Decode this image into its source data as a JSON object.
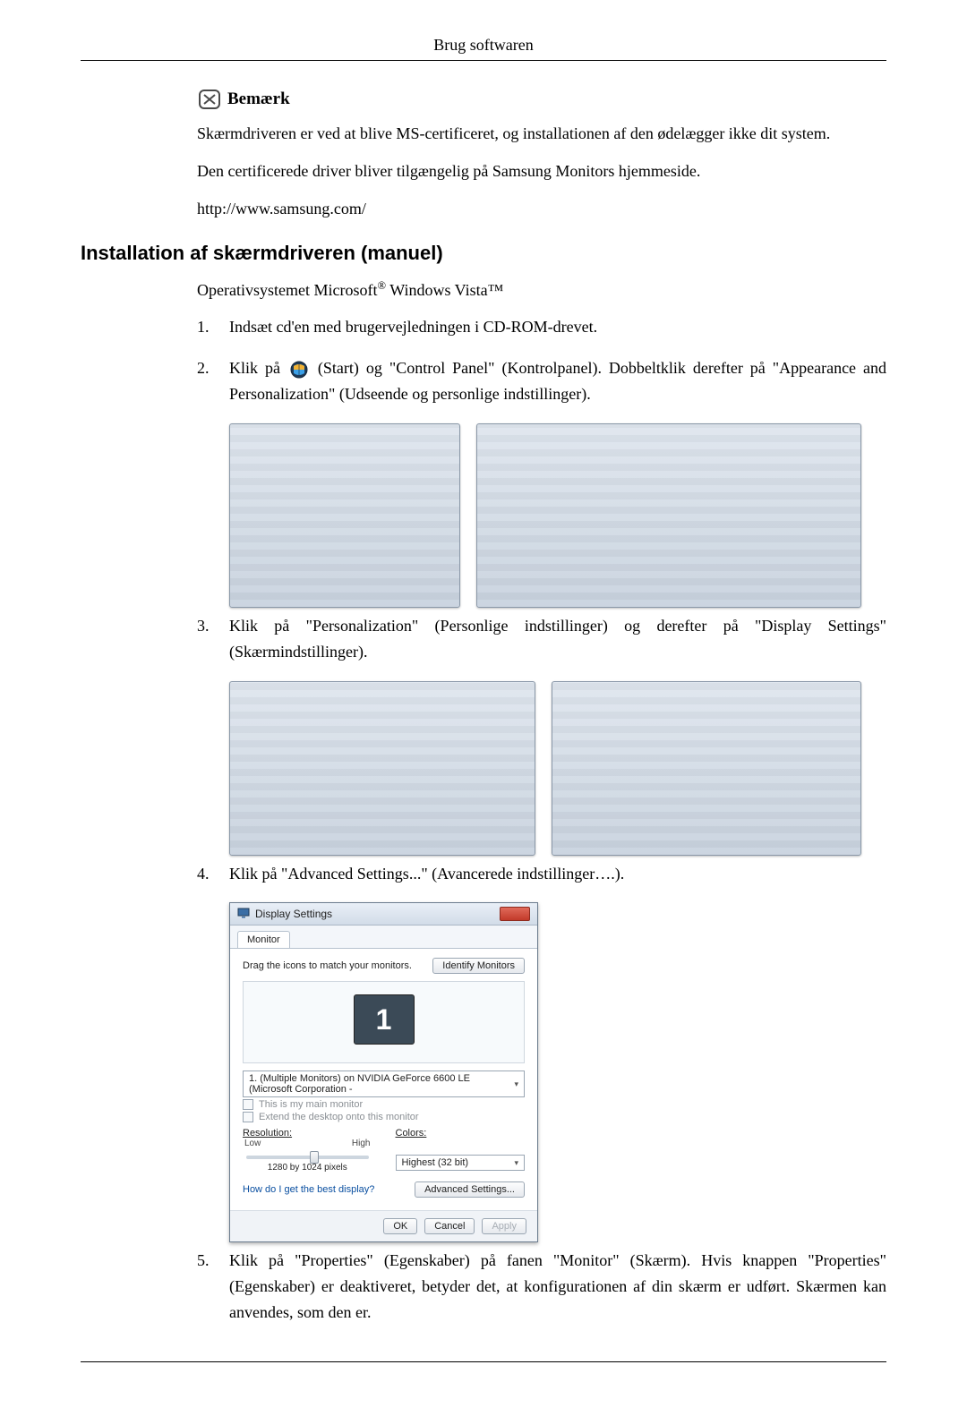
{
  "page_header": "Brug softwaren",
  "note": {
    "title": "Bemærk",
    "lines": [
      "Skærmdriveren er ved at blive MS-certificeret, og installationen af den ødelægger ikke dit system.",
      "Den certificerede driver bliver tilgængelig på Samsung Monitors hjemmeside.",
      "http://www.samsung.com/"
    ]
  },
  "section_title": "Installation af skærmdriveren (manuel)",
  "subtitle_pre": "Operativsystemet Microsoft",
  "subtitle_post": " Windows Vista™",
  "steps": [
    {
      "n": "1.",
      "text": "Indsæt cd'en med brugervejledningen i CD-ROM-drevet."
    },
    {
      "n": "2.",
      "pre": "Klik på ",
      "post": "(Start) og \"Control Panel\" (Kontrolpanel). Dobbeltklik derefter på \"Appearance and Personalization\" (Udseende og personlige indstillinger)."
    },
    {
      "n": "3.",
      "text": "Klik på \"Personalization\" (Personlige indstillinger) og derefter på \"Display Settings\" (Skærmindstillinger)."
    },
    {
      "n": "4.",
      "text": "Klik på \"Advanced Settings...\" (Avancerede indstillinger….)."
    },
    {
      "n": "5.",
      "text": "Klik på \"Properties\" (Egenskaber) på fanen \"Monitor\" (Skærm). Hvis knappen \"Properties\" (Egenskaber) er deaktiveret, betyder det, at konfigurationen af din skærm er udført. Skærmen kan anvendes, som den er."
    }
  ],
  "display_dialog": {
    "title": "Display Settings",
    "tab": "Monitor",
    "drag_label": "Drag the icons to match your monitors.",
    "identify_btn": "Identify Monitors",
    "monitor_number": "1",
    "monitor_dropdown": "1. (Multiple Monitors) on NVIDIA GeForce 6600 LE (Microsoft Corporation -",
    "cb_main": "This is my main monitor",
    "cb_extend": "Extend the desktop onto this monitor",
    "resolution_label": "Resolution:",
    "slider_low": "Low",
    "slider_high": "High",
    "resolution_value": "1280 by 1024 pixels",
    "colors_label": "Colors:",
    "colors_value": "Highest (32 bit)",
    "help_link": "How do I get the best display?",
    "advanced_btn": "Advanced Settings...",
    "ok": "OK",
    "cancel": "Cancel",
    "apply": "Apply"
  }
}
